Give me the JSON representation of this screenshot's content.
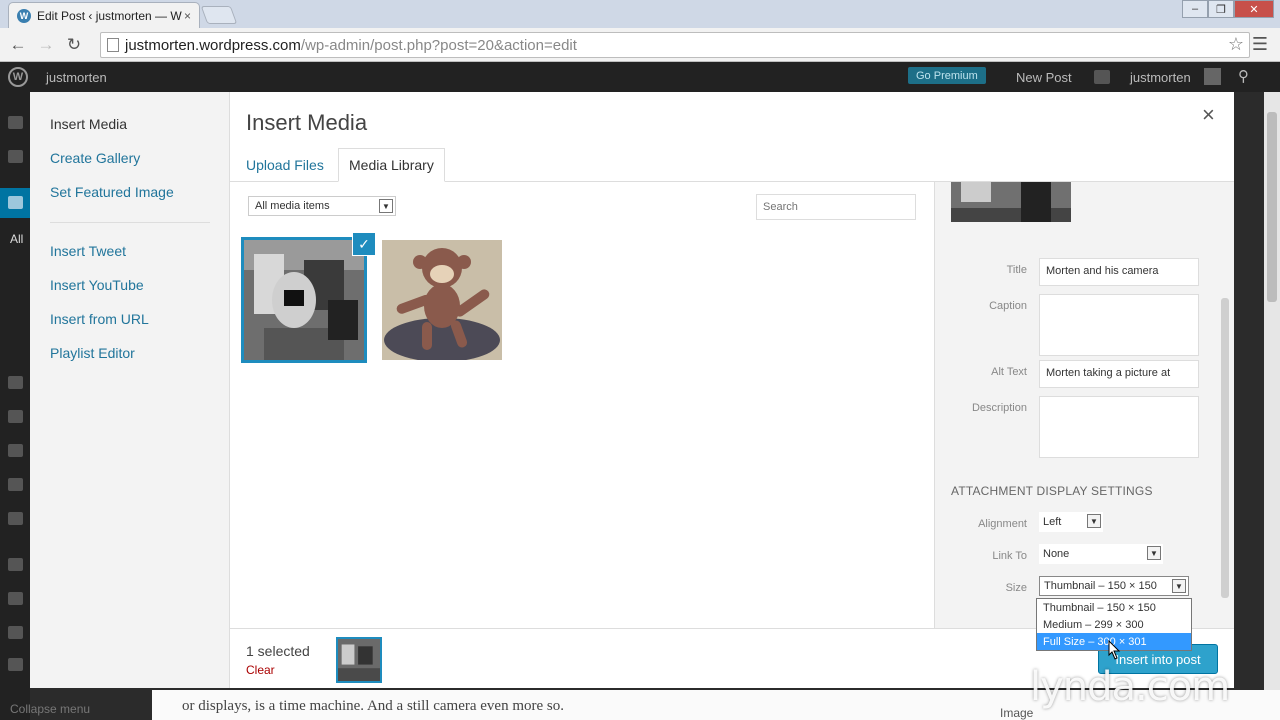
{
  "browser": {
    "tab_title": "Edit Post ‹ justmorten — W",
    "tab_close": "×",
    "url_host": "justmorten.wordpress.com",
    "url_path": "/wp-admin/post.php?post=20&action=edit"
  },
  "adminbar": {
    "site_name": "justmorten",
    "go_premium": "Go Premium",
    "new_post": "New Post",
    "user": "justmorten"
  },
  "wp_sidebar": {
    "all_label": "All",
    "collapse": "Collapse menu"
  },
  "behind": {
    "content_text": "or displays, is a time machine. And a still camera even more so.",
    "image_label": "Image"
  },
  "modal": {
    "title": "Insert Media",
    "close": "×",
    "menu": [
      "Insert Media",
      "Create Gallery",
      "Set Featured Image",
      "Insert Tweet",
      "Insert YouTube",
      "Insert from URL",
      "Playlist Editor"
    ],
    "tabs": [
      "Upload Files",
      "Media Library"
    ],
    "filter": "All media items",
    "search_placeholder": "Search"
  },
  "details": {
    "title_label": "Title",
    "title_value": "Morten and his camera",
    "caption_label": "Caption",
    "caption_value": "",
    "alt_label": "Alt Text",
    "alt_value": "Morten taking a picture at",
    "description_label": "Description",
    "description_value": "",
    "section_title": "ATTACHMENT DISPLAY SETTINGS",
    "alignment_label": "Alignment",
    "alignment_value": "Left",
    "link_label": "Link To",
    "link_value": "None",
    "size_label": "Size",
    "size_value": "Thumbnail – 150 × 150",
    "size_options": [
      "Thumbnail – 150 × 150",
      "Medium – 299 × 300",
      "Full Size – 300 × 301"
    ],
    "highlighted_option": 2
  },
  "footer": {
    "selected_count": "1 selected",
    "clear": "Clear",
    "insert_button": "Insert into post"
  },
  "watermark": "lynda.com",
  "colors": {
    "accent": "#1e8cbe",
    "link": "#21759b",
    "primary_button": "#2ea2cc"
  }
}
